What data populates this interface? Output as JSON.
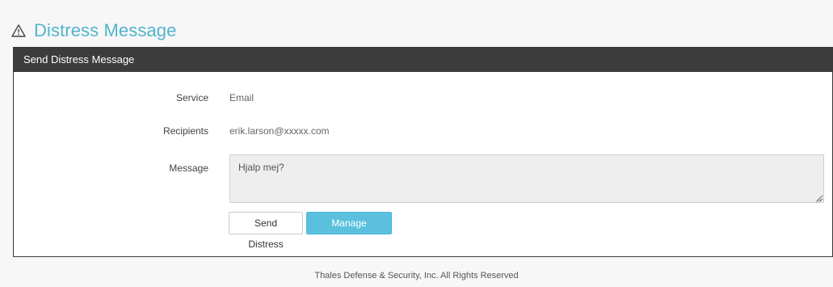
{
  "header": {
    "title": "Distress Message",
    "icon": "warning-icon"
  },
  "panel": {
    "heading": "Send Distress Message",
    "fields": {
      "service_label": "Service",
      "service_value": "Email",
      "recipients_label": "Recipients",
      "recipients_value": "erik.larson@xxxxx.com",
      "message_label": "Message",
      "message_value": "Hjalp mej?"
    },
    "buttons": {
      "send_label": "Send Distress",
      "manage_label": "Manage Distress"
    }
  },
  "footer": {
    "text": "Thales Defense & Security, Inc. All Rights Reserved"
  },
  "colors": {
    "title": "#52b4cc",
    "panel_heading_bg": "#3c3c3c",
    "info_button": "#5bc0de"
  }
}
